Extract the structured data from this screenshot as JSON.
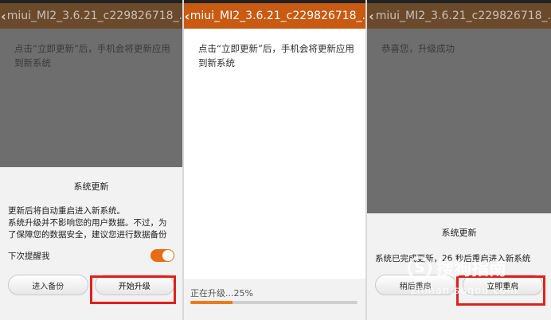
{
  "accent_color": "#e86c15",
  "highlight_color": "#e0211c",
  "panel1": {
    "title": "miui_MI2_3.6.21_c229826718_.",
    "back_icon": "chevron-left-icon",
    "hint": "点击“立即更新”后，手机会将更新应用到新系统",
    "dialog": {
      "title": "系统更新",
      "body": "更新后将自动重启进入新系统。\n系统升级并不影响您的用户数据。不过，为了保障您的数据安全，建议您进行数据备份",
      "toggle_label": "下次提醒我",
      "toggle_on": true,
      "backup_button": "进入备份",
      "upgrade_button": "开始升级"
    }
  },
  "panel2": {
    "title": "miui_MI2_3.6.21_c229826718_.",
    "back_icon": "chevron-left-icon",
    "hint": "点击“立即更新”后，手机会将更新应用到新系统",
    "progress_label": "正在升级...25%",
    "progress_fraction": 0.25
  },
  "panel3": {
    "title": "miui_MI2_3.6.21_c229826718_.",
    "back_icon": "chevron-left-icon",
    "hint": "恭喜您，升级成功",
    "dialog": {
      "title": "系统更新",
      "body": "系统已完成更新，26 秒后重启进入新系统",
      "later_button": "稍后重启",
      "restart_button": "立即重启"
    }
  },
  "watermark": {
    "brand": "搜狗指南",
    "url": "zhinan.sogou.com"
  }
}
